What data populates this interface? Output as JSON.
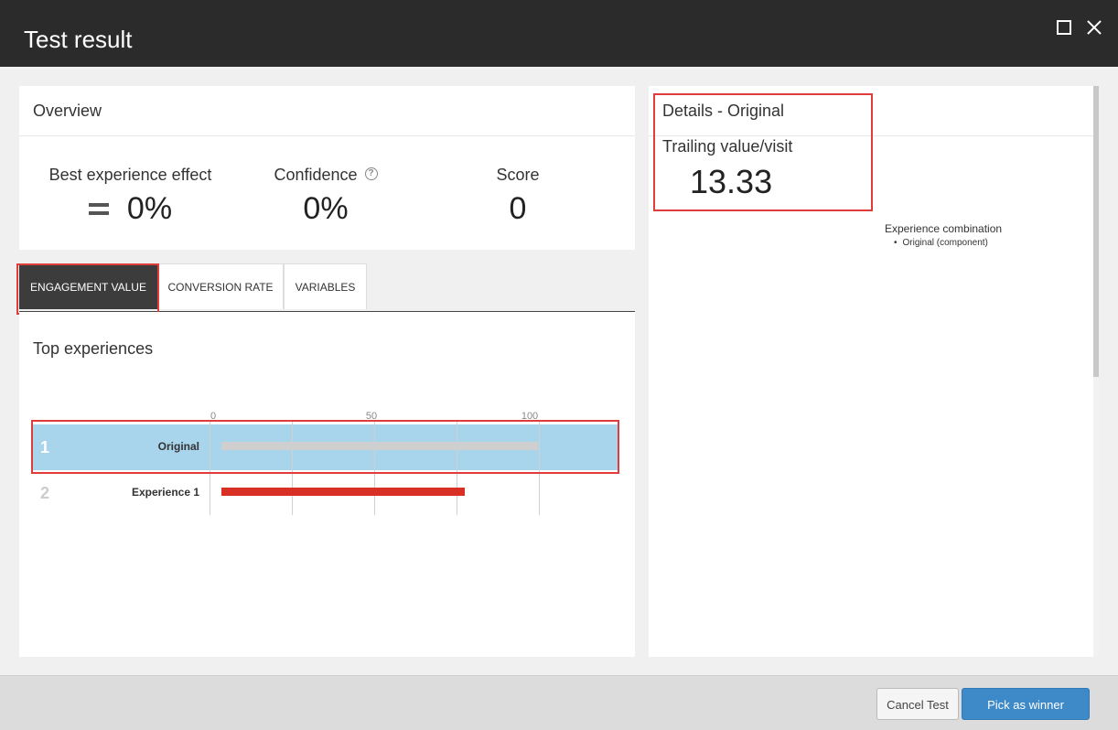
{
  "window": {
    "title": "Test result"
  },
  "overview": {
    "heading": "Overview",
    "best_effect_label": "Best experience effect",
    "best_effect_value": "0%",
    "confidence_label": "Confidence",
    "confidence_help": "?",
    "confidence_value": "0%",
    "score_label": "Score",
    "score_value": "0"
  },
  "tabs": [
    {
      "label": "ENGAGEMENT VALUE",
      "active": true
    },
    {
      "label": "CONVERSION RATE",
      "active": false
    },
    {
      "label": "VARIABLES",
      "active": false
    }
  ],
  "top_experiences": {
    "heading": "Top experiences",
    "rows": [
      {
        "rank": "1",
        "label": "Original",
        "selected": true
      },
      {
        "rank": "2",
        "label": "Experience 1",
        "selected": false
      }
    ]
  },
  "chart_data": {
    "type": "bar",
    "orientation": "horizontal",
    "categories": [
      "Original",
      "Experience 1"
    ],
    "values": [
      100,
      77
    ],
    "ticks": [
      "0",
      "50",
      "100"
    ],
    "xlim": [
      0,
      100
    ],
    "colors": [
      "#cfcfcf",
      "#d93025"
    ]
  },
  "details": {
    "heading": "Details - Original",
    "trailing_label": "Trailing value/visit",
    "trailing_value": "13.33",
    "combination_title": "Experience combination",
    "combination_items": [
      "Original (component)"
    ]
  },
  "footer": {
    "cancel_label": "Cancel Test",
    "pick_label": "Pick as winner"
  },
  "colors": {
    "titlebar": "#2b2b2b",
    "accent_blue": "#3e8ac8",
    "highlight_red": "#e03c3c",
    "selected_row": "#a8d4ec"
  }
}
